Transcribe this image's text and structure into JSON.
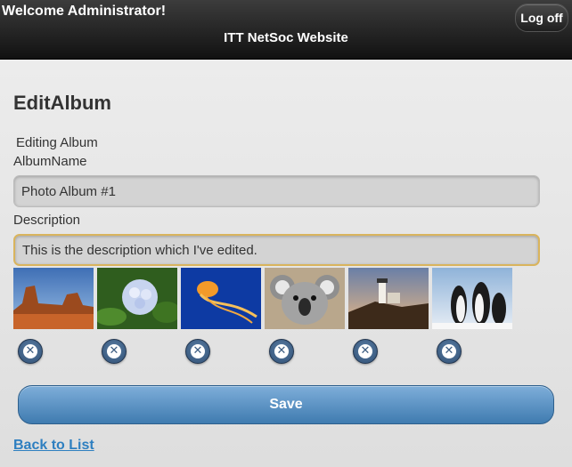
{
  "header": {
    "welcome": "Welcome Administrator!",
    "site_title": "ITT NetSoc Website",
    "logoff_label": "Log off"
  },
  "main": {
    "page_title": "EditAlbum",
    "subtitle": "Editing Album",
    "album_name_label": "AlbumName",
    "album_name_value": "Photo Album #1",
    "description_label": "Description",
    "description_value": "This is the description which I've edited.",
    "photos": [
      {
        "name": "desert-photo"
      },
      {
        "name": "hydrangea-photo"
      },
      {
        "name": "jellyfish-photo"
      },
      {
        "name": "koala-photo"
      },
      {
        "name": "lighthouse-photo"
      },
      {
        "name": "penguins-photo"
      }
    ],
    "remove_icon": "x-icon",
    "save_label": "Save",
    "back_link": "Back to List"
  },
  "colors": {
    "header_bg": "#1f1f1f",
    "save_bg": "#4f8abf",
    "link": "#2e7fc0",
    "focus_border": "#d9b45d"
  }
}
